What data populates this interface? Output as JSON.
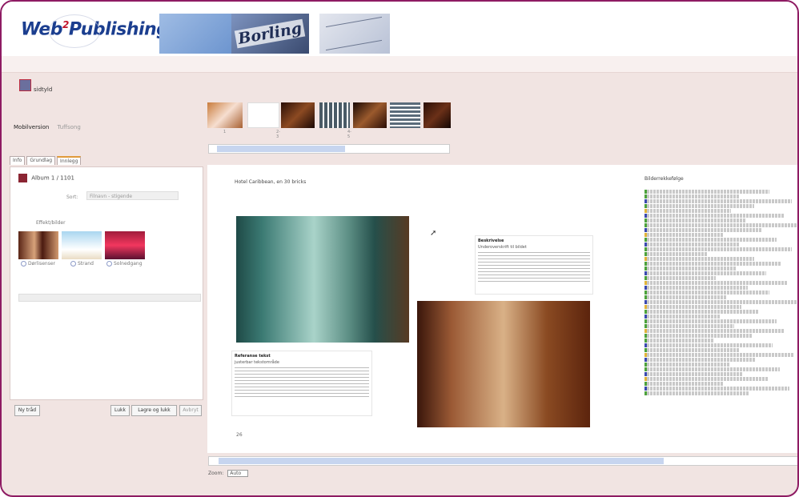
{
  "header": {
    "logo_prefix": "Web",
    "logo_sup": "2",
    "logo_suffix": "Publishing",
    "banner_sign_text": "Borling"
  },
  "page_title": "sidtyld",
  "nav_tabs": [
    "Mobilversion",
    "Tuffsong"
  ],
  "left_tabs": [
    "Info",
    "Grundlag",
    "Innlegg"
  ],
  "left_panel": {
    "album_label": "Album 1 / 1101",
    "sort_label": "Sort:",
    "sort_value": "Filnavn - stigende",
    "effects_heading": "Effekt/bilder",
    "radios": [
      "Dørlisenser",
      "Strand",
      "Solnedgang"
    ]
  },
  "left_footer": {
    "new_label": "Ny tråd",
    "btn3_label": "Lukk",
    "save_label": "Lagre og lukk",
    "close_label": "Avbryt"
  },
  "filmstrip_nums": [
    "1",
    "2-3",
    "4-5"
  ],
  "canvas": {
    "title": "Hotel Caribbean, en 30 bricks",
    "text1_heading": "Referanse tekst",
    "text1_sub": "justerbar tekstområde",
    "text2_heading": "Beskrivelse",
    "text2_sub": "Underoverskrift til bildet",
    "pin": "26"
  },
  "rightcol_title": "Bilderrekkefølge",
  "zoom": {
    "label": "Zoom:",
    "value": "Auto"
  }
}
